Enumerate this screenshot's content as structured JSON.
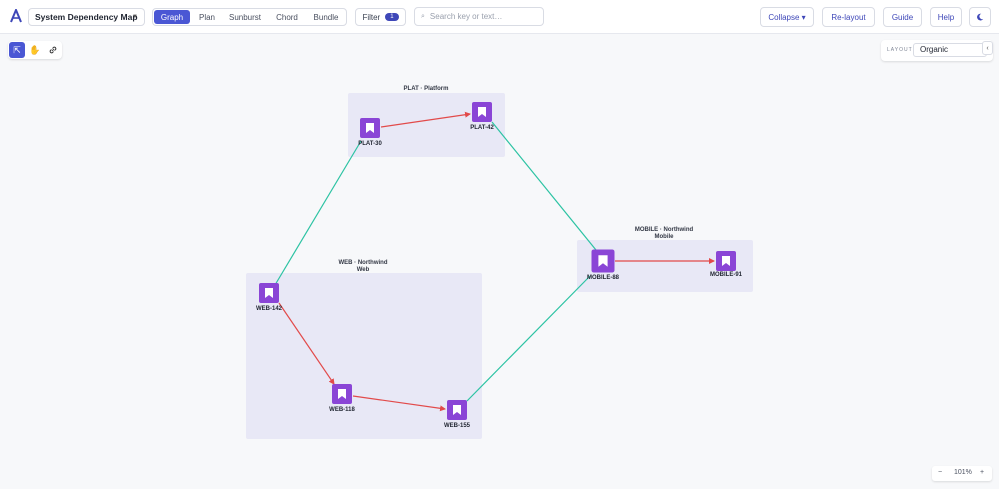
{
  "header": {
    "project_name": "System Dependency Map",
    "tabs": [
      "Graph",
      "Plan",
      "Sunburst",
      "Chord",
      "Bundle"
    ],
    "active_tab": "Graph",
    "filter_label": "Filter",
    "filter_count": "1",
    "search_placeholder": "Search key or text…",
    "collapse_label": "Collapse ▾",
    "relayout_label": "Re-layout",
    "guide_label": "Guide",
    "help_label": "Help"
  },
  "layout_panel": {
    "label": "LAYOUT",
    "value": "Organic"
  },
  "zoom": {
    "minus": "−",
    "level": "101%",
    "plus": "+"
  },
  "groups": {
    "plat": "PLAT · Platform",
    "mobile_line1": "MOBILE · Northwind",
    "mobile_line2": "Mobile",
    "web_line1": "WEB · Northwind",
    "web_line2": "Web"
  },
  "nodes": {
    "plat30": "PLAT-30",
    "plat42": "PLAT-42",
    "mobile88": "MOBILE-88",
    "mobile91": "MOBILE-91",
    "web142": "WEB-142",
    "web118": "WEB-118",
    "web155": "WEB-155"
  },
  "colors": {
    "accent": "#4a57d4",
    "node": "#8a45d6",
    "edge_dependency": "#e24a4a",
    "edge_cross": "#2cc3a3",
    "group_fill": "#e8e8f6"
  }
}
